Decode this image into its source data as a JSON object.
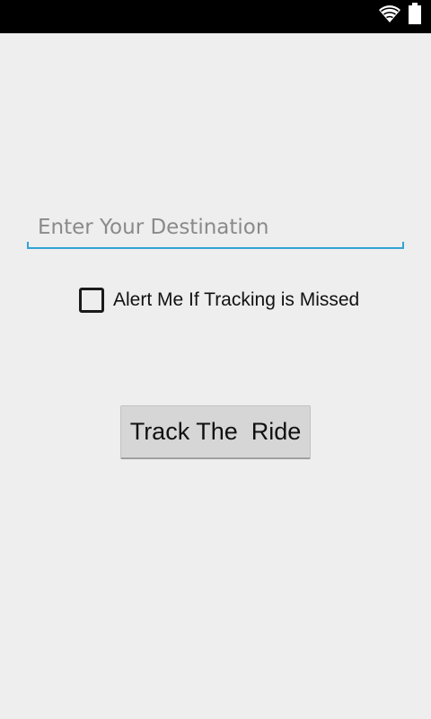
{
  "status_bar": {
    "icons": [
      "wifi-icon",
      "battery-icon"
    ],
    "background": "#000000"
  },
  "destination": {
    "placeholder": "Enter Your Destination",
    "value": "",
    "underline_color": "#33a3d5"
  },
  "alert_checkbox": {
    "label": "Alert Me If Tracking is Missed",
    "checked": false
  },
  "track_button": {
    "label": "Track The  Ride"
  },
  "colors": {
    "background": "#eeeeee",
    "button": "#d6d6d6"
  }
}
